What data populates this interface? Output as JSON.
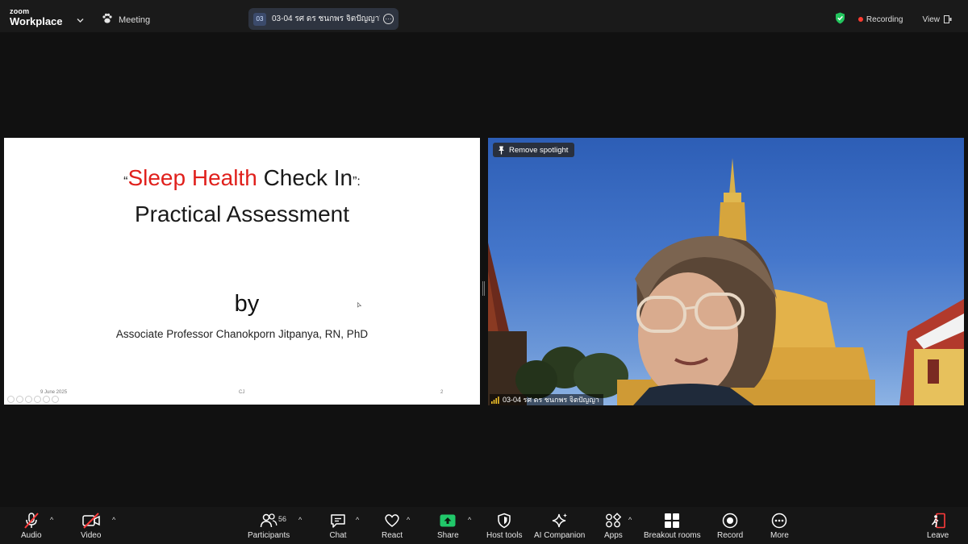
{
  "app": {
    "brand_top": "zoom",
    "brand_bottom": "Workplace"
  },
  "meeting_label": "Meeting",
  "share_pill": {
    "avatar": "03",
    "text": "03-04 รศ ดร ชนกพร จิตปัญญา's screen"
  },
  "status": {
    "recording": "Recording",
    "view": "View"
  },
  "slide": {
    "quote_open": "“",
    "title_red": "Sleep Health",
    "title_rest": " Check In",
    "quote_close": "”:",
    "title_line2": "Practical Assessment",
    "by": "by",
    "author": "Associate Professor Chanokporn Jitpanya, RN, PhD",
    "footer_date": "9 June 2025",
    "footer_center": "CJ",
    "footer_page": "2"
  },
  "video": {
    "spotlight_label": "Remove spotlight",
    "participant_name": "03-04 รศ ดร ชนกพร จิตปัญญา"
  },
  "toolbar": {
    "audio": "Audio",
    "video": "Video",
    "participants": "Participants",
    "participants_count": "56",
    "chat": "Chat",
    "react": "React",
    "share": "Share",
    "host_tools": "Host tools",
    "ai_companion": "AI Companion",
    "apps": "Apps",
    "breakout_rooms": "Breakout rooms",
    "record": "Record",
    "more": "More",
    "leave": "Leave"
  },
  "colors": {
    "accent_green": "#23c55e",
    "share_green": "#21c86a",
    "leave_red": "#ff3b3b",
    "slide_title_red": "#e0201c"
  }
}
